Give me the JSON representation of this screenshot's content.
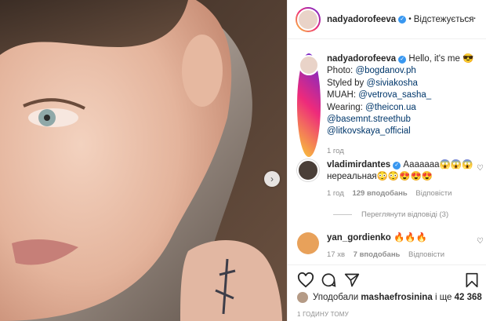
{
  "post": {
    "username": "nadyadorofeeva",
    "follow_status": "Відстежується",
    "more_icon": "more-icon"
  },
  "caption": {
    "username": "nadyadorofeeva",
    "text": "Hello, it's me 😎",
    "photo_label": "Photo:",
    "photo_handle": "@bogdanov.ph",
    "styled_label": "Styled by",
    "styled_handle": "@siviakosha",
    "muah_label": "MUAH:",
    "muah_handle": "@vetrova_sasha_",
    "wearing_label": "Wearing:",
    "wearing_handle_1": "@theicon.ua",
    "wearing_handle_2": "@basemnt.streethub",
    "wearing_handle_3": "@litkovskaya_official",
    "time": "1 год"
  },
  "comments": [
    {
      "username": "vladimirdantes",
      "text": "Ааааааа😱😱😱 нереальная😳😳😍😍😍",
      "time": "1 год",
      "likes": "129 вподобань",
      "reply": "Відповісти",
      "view_replies": "Переглянути відповіді (3)"
    },
    {
      "username": "yan_gordienko",
      "text": "🔥🔥🔥",
      "time": "17 хв",
      "likes": "7 вподобань",
      "reply": "Відповісти"
    }
  ],
  "likes": {
    "prefix": "Уподобали",
    "user": "mashaefrosinina",
    "suffix": "і ще",
    "count": "42 368"
  },
  "timestamp": "1 ГОДИНУ ТОМУ",
  "colors": {
    "verified": "#3897f0",
    "link": "#00376b",
    "meta": "#8e8e8e"
  }
}
